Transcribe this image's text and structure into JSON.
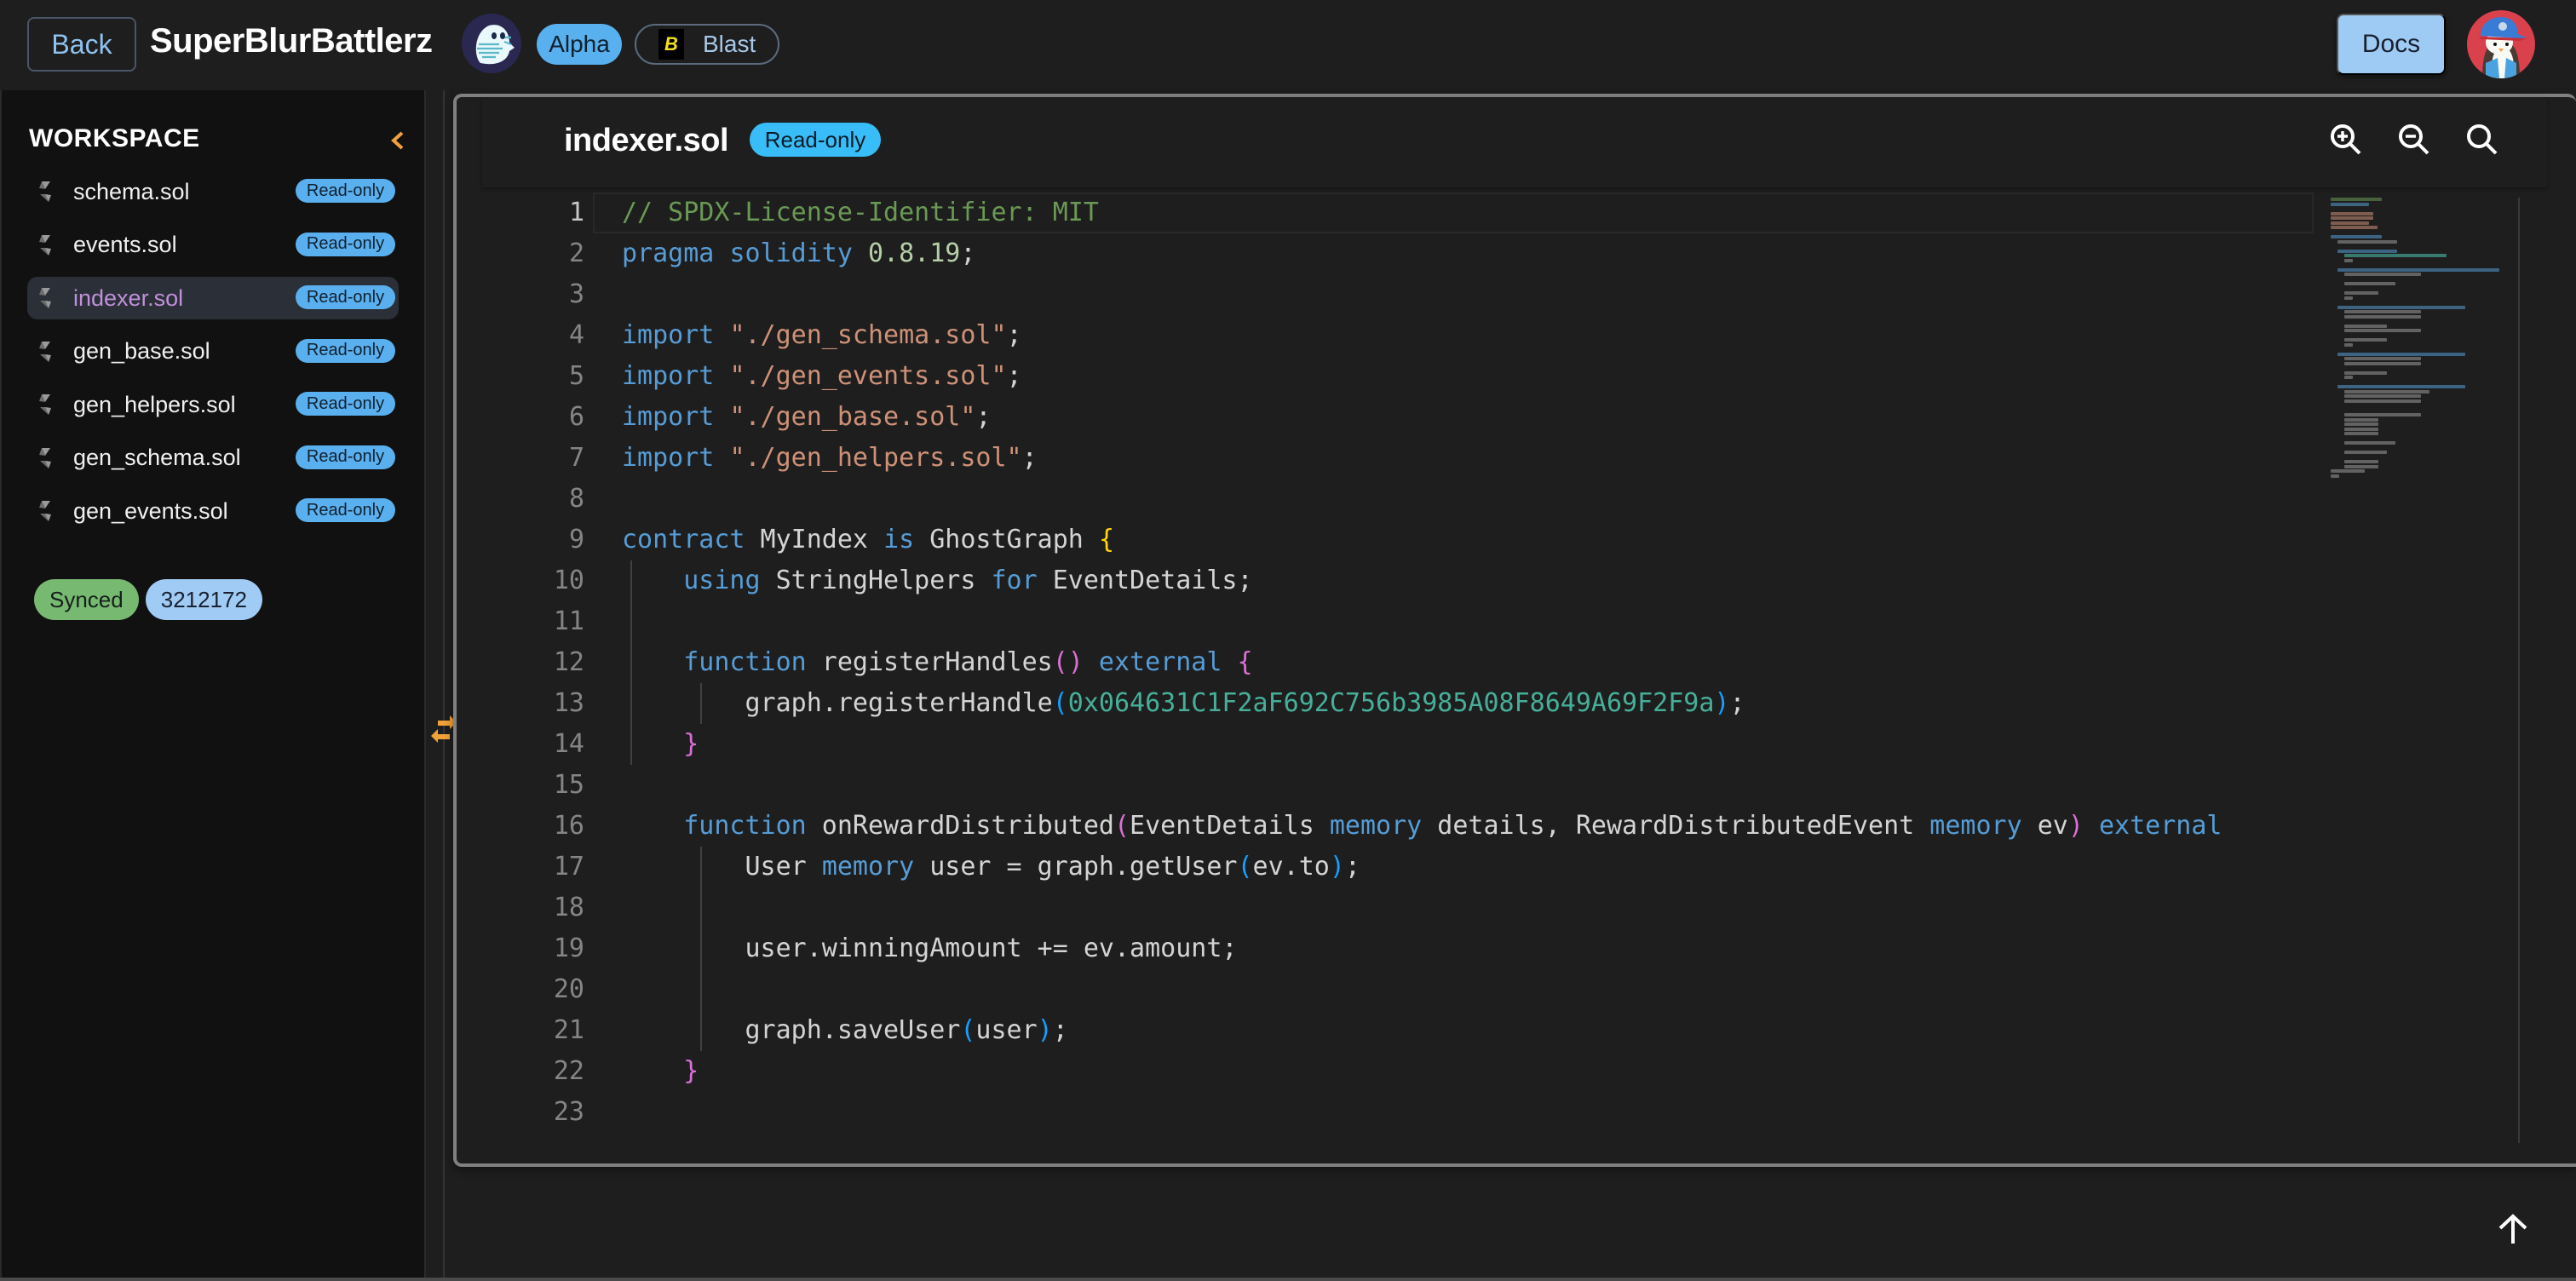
{
  "header": {
    "back_label": "Back",
    "app_title": "SuperBlurBattlerz",
    "logo_icon": "ghost-logo-icon",
    "stage_badge": "Alpha",
    "chain_badge": "Blast",
    "chain_icon": "blast-logo-icon",
    "docs_label": "Docs",
    "avatar_icon": "penguin-avatar-icon"
  },
  "sidebar": {
    "title": "WORKSPACE",
    "collapse_icon": "chevron-left-icon",
    "files": [
      {
        "name": "schema.sol",
        "badge": "Read-only",
        "active": false
      },
      {
        "name": "events.sol",
        "badge": "Read-only",
        "active": false
      },
      {
        "name": "indexer.sol",
        "badge": "Read-only",
        "active": true
      },
      {
        "name": "gen_base.sol",
        "badge": "Read-only",
        "active": false
      },
      {
        "name": "gen_helpers.sol",
        "badge": "Read-only",
        "active": false
      },
      {
        "name": "gen_schema.sol",
        "badge": "Read-only",
        "active": false
      },
      {
        "name": "gen_events.sol",
        "badge": "Read-only",
        "active": false
      }
    ],
    "sync_status": "Synced",
    "block_number": "3212172"
  },
  "editor": {
    "filename": "indexer.sol",
    "badge": "Read-only",
    "toolbar": [
      "zoom-in-icon",
      "zoom-out-icon",
      "search-icon"
    ],
    "current_line": 1,
    "lines": [
      {
        "n": "1",
        "tokens": [
          [
            "cm",
            "// SPDX-License-Identifier: MIT"
          ]
        ]
      },
      {
        "n": "2",
        "tokens": [
          [
            "kw",
            "pragma"
          ],
          [
            "",
            " "
          ],
          [
            "kw",
            "solidity"
          ],
          [
            "",
            " "
          ],
          [
            "num",
            "0.8.19"
          ],
          [
            "",
            ";"
          ]
        ]
      },
      {
        "n": "3",
        "tokens": []
      },
      {
        "n": "4",
        "tokens": [
          [
            "kw",
            "import"
          ],
          [
            "",
            " "
          ],
          [
            "str",
            "\"./gen_schema.sol\""
          ],
          [
            "",
            ";"
          ]
        ]
      },
      {
        "n": "5",
        "tokens": [
          [
            "kw",
            "import"
          ],
          [
            "",
            " "
          ],
          [
            "str",
            "\"./gen_events.sol\""
          ],
          [
            "",
            ";"
          ]
        ]
      },
      {
        "n": "6",
        "tokens": [
          [
            "kw",
            "import"
          ],
          [
            "",
            " "
          ],
          [
            "str",
            "\"./gen_base.sol\""
          ],
          [
            "",
            ";"
          ]
        ]
      },
      {
        "n": "7",
        "tokens": [
          [
            "kw",
            "import"
          ],
          [
            "",
            " "
          ],
          [
            "str",
            "\"./gen_helpers.sol\""
          ],
          [
            "",
            ";"
          ]
        ]
      },
      {
        "n": "8",
        "tokens": []
      },
      {
        "n": "9",
        "tokens": [
          [
            "kw",
            "contract"
          ],
          [
            "",
            " MyIndex "
          ],
          [
            "kw",
            "is"
          ],
          [
            "",
            " GhostGraph "
          ],
          [
            "br1",
            "{"
          ]
        ]
      },
      {
        "n": "10",
        "tokens": [
          [
            "",
            "    "
          ],
          [
            "kw",
            "using"
          ],
          [
            "",
            " StringHelpers "
          ],
          [
            "kw",
            "for"
          ],
          [
            "",
            " EventDetails;"
          ]
        ]
      },
      {
        "n": "11",
        "tokens": []
      },
      {
        "n": "12",
        "tokens": [
          [
            "",
            "    "
          ],
          [
            "kw",
            "function"
          ],
          [
            "",
            " registerHandles"
          ],
          [
            "br2",
            "()"
          ],
          [
            "",
            " "
          ],
          [
            "kw",
            "external"
          ],
          [
            "",
            " "
          ],
          [
            "br2",
            "{"
          ]
        ]
      },
      {
        "n": "13",
        "tokens": [
          [
            "",
            "        graph.registerHandle"
          ],
          [
            "br3",
            "("
          ],
          [
            "hex",
            "0x064631C1F2aF692C756b3985A08F8649A69F2F9a"
          ],
          [
            "br3",
            ")"
          ],
          [
            "",
            ";"
          ]
        ]
      },
      {
        "n": "14",
        "tokens": [
          [
            "",
            "    "
          ],
          [
            "br2",
            "}"
          ]
        ]
      },
      {
        "n": "15",
        "tokens": []
      },
      {
        "n": "16",
        "tokens": [
          [
            "",
            "    "
          ],
          [
            "kw",
            "function"
          ],
          [
            "",
            " onRewardDistributed"
          ],
          [
            "br2",
            "("
          ],
          [
            "",
            "EventDetails "
          ],
          [
            "kw",
            "memory"
          ],
          [
            "",
            " details, RewardDistributedEvent "
          ],
          [
            "kw",
            "memory"
          ],
          [
            "",
            " ev"
          ],
          [
            "br2",
            ")"
          ],
          [
            "",
            " "
          ],
          [
            "kw",
            "external"
          ]
        ]
      },
      {
        "n": "17",
        "tokens": [
          [
            "",
            "        User "
          ],
          [
            "kw",
            "memory"
          ],
          [
            "",
            " user = graph.getUser"
          ],
          [
            "br3",
            "("
          ],
          [
            "",
            "ev.to"
          ],
          [
            "br3",
            ")"
          ],
          [
            "",
            ";"
          ]
        ]
      },
      {
        "n": "18",
        "tokens": []
      },
      {
        "n": "19",
        "tokens": [
          [
            "",
            "        user.winningAmount += ev.amount;"
          ]
        ]
      },
      {
        "n": "20",
        "tokens": []
      },
      {
        "n": "21",
        "tokens": [
          [
            "",
            "        graph.saveUser"
          ],
          [
            "br3",
            "("
          ],
          [
            "",
            "user"
          ],
          [
            "br3",
            ")"
          ],
          [
            "",
            ";"
          ]
        ]
      },
      {
        "n": "22",
        "tokens": [
          [
            "",
            "    "
          ],
          [
            "br2",
            "}"
          ]
        ]
      },
      {
        "n": "23",
        "tokens": []
      }
    ]
  },
  "misc": {
    "resize_icon": "swap-horizontal-icon",
    "scroll_top_icon": "arrow-up-icon"
  }
}
